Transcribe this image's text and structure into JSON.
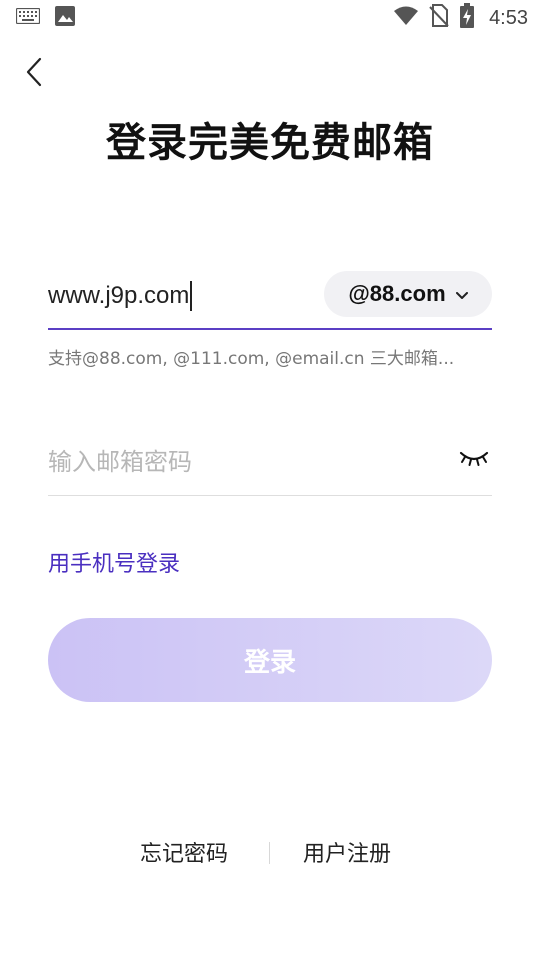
{
  "status_bar": {
    "time": "4:53",
    "icons": [
      "keyboard-icon",
      "image-icon",
      "wifi-icon",
      "no-sim-icon",
      "battery-charging-icon"
    ]
  },
  "header": {
    "back_icon": "back-arrow-icon",
    "title": "登录完美免费邮箱"
  },
  "email": {
    "value": "www.j9p.com",
    "domain": "@88.com",
    "domain_icon": "chevron-down-icon",
    "hint": "支持@88.com, @111.com, @email.cn 三大邮箱..."
  },
  "password": {
    "placeholder": "输入邮箱密码",
    "toggle_icon": "eye-closed-icon"
  },
  "phone_login_label": "用手机号登录",
  "login_button_label": "登录",
  "footer": {
    "forgot_label": "忘记密码",
    "register_label": "用户注册"
  },
  "colors": {
    "accent": "#5b3fc4",
    "link": "#4a2fc0",
    "button_start": "#cbc2f5",
    "button_end": "#dcd8f8"
  }
}
